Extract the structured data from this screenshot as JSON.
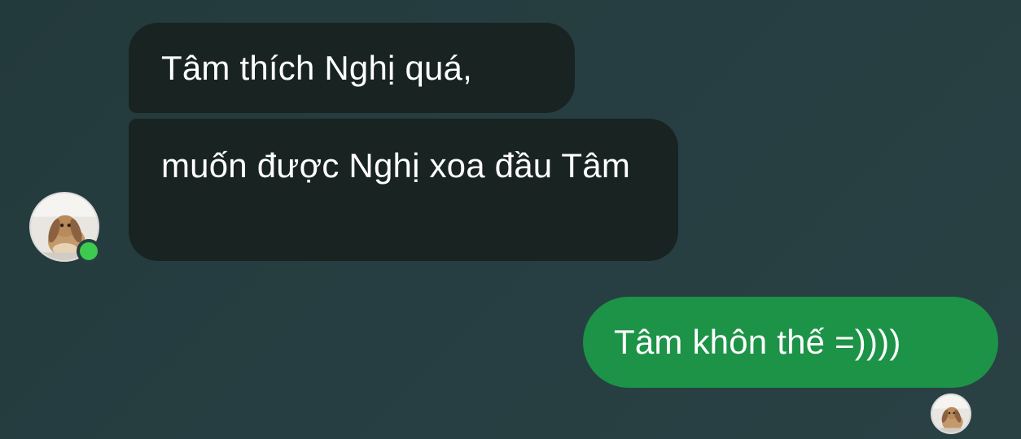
{
  "conversation": {
    "messages": [
      {
        "direction": "incoming",
        "text": "Tâm thích Nghị quá,"
      },
      {
        "direction": "incoming",
        "text": "muốn được Nghị xoa đầu Tâm"
      },
      {
        "direction": "outgoing",
        "text": "Tâm khôn thế =))))"
      }
    ]
  },
  "peer": {
    "avatar_icon": "rabbit-avatar-icon",
    "status": "online",
    "status_color": "#3ec94f"
  },
  "self": {
    "avatar_icon": "rabbit-avatar-icon"
  },
  "colors": {
    "background": "#263e41",
    "incoming_bubble": "#182322",
    "outgoing_bubble": "#1c9347",
    "text": "#ffffff"
  }
}
